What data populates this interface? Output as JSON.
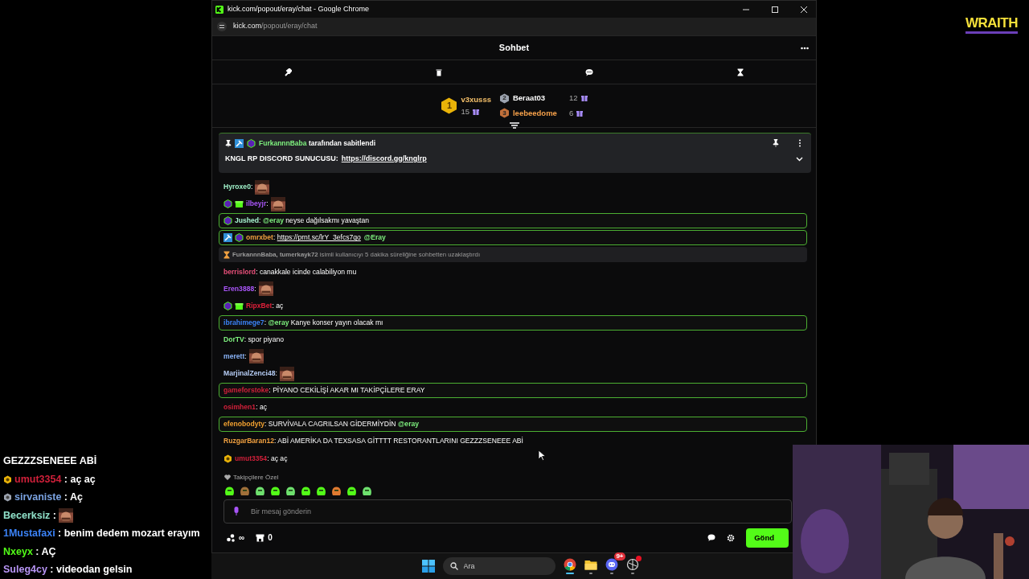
{
  "browser": {
    "title": "kick.com/popout/eray/chat - Google Chrome",
    "url_host": "kick.com",
    "url_path": "/popout/eray/chat"
  },
  "chat_header": {
    "title": "Sohbet"
  },
  "leaderboard": [
    {
      "rank": "1",
      "kind": "gold",
      "name": "v3xusss",
      "count": "15",
      "color": "#f5c06a"
    },
    {
      "rank": "2",
      "kind": "silver",
      "name": "Beraat03",
      "count": "12",
      "color": "#ffffff"
    },
    {
      "rank": "3",
      "kind": "bronze",
      "name": "leebeedome",
      "count": "6",
      "color": "#f5a04a"
    }
  ],
  "pinned": {
    "badges": [
      {
        "kind": "moderator"
      },
      {
        "kind": "subscriber"
      }
    ],
    "user": "FurkannnBaba",
    "color": "#7ef07e",
    "note": "tarafından sabitlendi",
    "text": "KNGL RP DISCORD SUNUCUSU:",
    "link": "https://discord.gg/knglrp"
  },
  "messages": [
    {
      "kind": "message",
      "user": "Hyroxe0",
      "color": "#9ff0c8",
      "highlighted": false,
      "parts": [
        {
          "kind": "text",
          "text": ":"
        },
        {
          "kind": "emote"
        }
      ]
    },
    {
      "kind": "message",
      "user": "ilbeyjr",
      "color": "#a855f7",
      "highlighted": false,
      "badges": [
        {
          "kind": "subscriber"
        },
        {
          "kind": "gift"
        }
      ],
      "parts": [
        {
          "kind": "text",
          "text": ":"
        },
        {
          "kind": "emote"
        }
      ]
    },
    {
      "kind": "message",
      "user": "Jushed",
      "color": "#a7f3d0",
      "highlighted": true,
      "badges": [
        {
          "kind": "subscriber"
        }
      ],
      "parts": [
        {
          "kind": "text",
          "text": ": "
        },
        {
          "kind": "mention",
          "text": "@eray"
        },
        {
          "kind": "text",
          "text": " neyse dağılsakmı yavaştan"
        }
      ]
    },
    {
      "kind": "message",
      "user": "omrxbet",
      "color": "#f0a040",
      "highlighted": true,
      "badges": [
        {
          "kind": "moderator"
        },
        {
          "kind": "subscriber"
        }
      ],
      "parts": [
        {
          "kind": "text",
          "text": ": "
        },
        {
          "kind": "link",
          "text": "https://prnt.sc/lrY_3efcs7qo"
        },
        {
          "kind": "mention",
          "text": "@Eray"
        }
      ]
    },
    {
      "kind": "timeout",
      "text": "**FurkannnBaba, tumerkayk72** isimli kullanıcıyı 5 dakika süreliğine sohbetten uzaklaştırdı"
    },
    {
      "kind": "message",
      "user": "berrislord",
      "color": "#e8507a",
      "highlighted": false,
      "parts": [
        {
          "kind": "text",
          "text": ": canakkale icinde calabiliyon mu"
        }
      ]
    },
    {
      "kind": "message",
      "user": "Eren3888",
      "color": "#a855f7",
      "highlighted": false,
      "parts": [
        {
          "kind": "text",
          "text": ":"
        },
        {
          "kind": "emote"
        }
      ]
    },
    {
      "kind": "message",
      "user": "RipxBet",
      "color": "#e0203a",
      "highlighted": false,
      "badges": [
        {
          "kind": "subscriber"
        },
        {
          "kind": "gift"
        }
      ],
      "parts": [
        {
          "kind": "text",
          "text": ": aç"
        }
      ]
    },
    {
      "kind": "message",
      "user": "ibrahimege7",
      "color": "#3b82f6",
      "highlighted": true,
      "parts": [
        {
          "kind": "text",
          "text": ": "
        },
        {
          "kind": "mention",
          "text": "@eray"
        },
        {
          "kind": "text",
          "text": " Kanye konser yayın olacak mı"
        }
      ]
    },
    {
      "kind": "message",
      "user": "DorTV",
      "color": "#7ef07e",
      "highlighted": false,
      "parts": [
        {
          "kind": "text",
          "text": ": spor piyano"
        }
      ]
    },
    {
      "kind": "message",
      "user": "merett",
      "color": "#8ab4f8",
      "highlighted": false,
      "parts": [
        {
          "kind": "text",
          "text": ":"
        },
        {
          "kind": "emote"
        }
      ]
    },
    {
      "kind": "message",
      "user": "MarjinalZenci48",
      "color": "#b6cdf5",
      "highlighted": false,
      "parts": [
        {
          "kind": "text",
          "text": ":"
        },
        {
          "kind": "emote"
        }
      ]
    },
    {
      "kind": "message",
      "user": "gameforstoke",
      "color": "#d0203a",
      "highlighted": true,
      "parts": [
        {
          "kind": "text",
          "text": ": PİYANO CEKİLİŞİ AKAR MI TAKİPÇİLERE ERAY"
        }
      ]
    },
    {
      "kind": "message",
      "user": "osimhen1",
      "color": "#d0203a",
      "highlighted": false,
      "parts": [
        {
          "kind": "text",
          "text": ": aç"
        }
      ]
    },
    {
      "kind": "message",
      "user": "efenobodyty",
      "color": "#f0a030",
      "highlighted": true,
      "parts": [
        {
          "kind": "text",
          "text": ": SURVİVALA CAGRILSAN GİDERMİYDİN "
        },
        {
          "kind": "mention",
          "text": "@eray"
        }
      ]
    },
    {
      "kind": "message",
      "user": "RuzgarBaran12",
      "color": "#f0a040",
      "highlighted": false,
      "parts": [
        {
          "kind": "text",
          "text": ": ABİ AMERİKA DA TEXSASA GİTTTT RESTORANTLARINI GEZZZSENEEE ABİ"
        }
      ]
    },
    {
      "kind": "message",
      "user": "umut3354",
      "color": "#d0203a",
      "highlighted": false,
      "badges": [
        {
          "kind": "founder"
        }
      ],
      "parts": [
        {
          "kind": "text",
          "text": ": aç aç"
        }
      ]
    }
  ],
  "follower_emotes": {
    "label": "Takipçilere Özel",
    "emotes": [
      {
        "color": "#53fc18"
      },
      {
        "color": "#a0703a"
      },
      {
        "color": "#6ee06e"
      },
      {
        "color": "#53fc18"
      },
      {
        "color": "#6ee06e"
      },
      {
        "color": "#53fc18"
      },
      {
        "color": "#53fc18"
      },
      {
        "color": "#e07a30"
      },
      {
        "color": "#53fc18"
      },
      {
        "color": "#6ee06e"
      }
    ]
  },
  "composer": {
    "placeholder": "Bir mesaj gönderin",
    "points": "∞",
    "store_count": "0",
    "send_label": "Gönd"
  },
  "overlay_chat": [
    {
      "parts": [
        {
          "kind": "text",
          "text": "GEZZZSENEEE ABİ"
        }
      ]
    },
    {
      "user": "umut3354",
      "color": "#d0203a",
      "badges": [
        {
          "kind": "founder"
        }
      ],
      "parts": [
        {
          "kind": "text",
          "text": " : aç aç"
        }
      ]
    },
    {
      "user": "sirvaniste",
      "color": "#7aa2e0",
      "badges": [
        {
          "kind": "silver"
        }
      ],
      "parts": [
        {
          "kind": "text",
          "text": " : Aç"
        }
      ]
    },
    {
      "user": "Becerksiz",
      "color": "#8fe0c8",
      "parts": [
        {
          "kind": "text",
          "text": " :"
        },
        {
          "kind": "emote"
        }
      ]
    },
    {
      "user": "1Mustafaxi",
      "color": "#3b82f6",
      "parts": [
        {
          "kind": "text",
          "text": " : benim dedem mozart erayım"
        }
      ]
    },
    {
      "user": "Nxeyx",
      "color": "#53fc18",
      "parts": [
        {
          "kind": "text",
          "text": " : AÇ"
        }
      ]
    },
    {
      "user": "Suleg4cy",
      "color": "#b794f4",
      "parts": [
        {
          "kind": "text",
          "text": " : videodan gelsin"
        }
      ]
    }
  ],
  "taskbar": {
    "search_placeholder": "Ara",
    "apps": [
      {
        "kind": "browser",
        "active": true,
        "notification": false
      },
      {
        "kind": "folder",
        "active": false,
        "notification": false
      },
      {
        "kind": "discord",
        "active": false,
        "notification": false,
        "badge": "9+"
      },
      {
        "kind": "app",
        "active": false,
        "notification": true
      }
    ]
  },
  "logo": "WRAITH"
}
